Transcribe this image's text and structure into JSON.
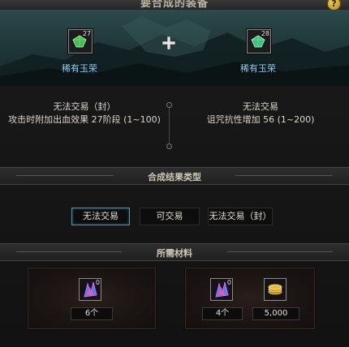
{
  "header": {
    "title": "要合成的装备",
    "help": "?"
  },
  "left_item": {
    "name": "稀有玉荣",
    "count": "27",
    "trade": "无法交易（封）",
    "effect": "攻击时附加出血效果 27阶段 (1~100)"
  },
  "right_item": {
    "name": "稀有玉荣",
    "count": "28",
    "trade": "无法交易",
    "effect": "诅咒抗性增加 56 (1~200)"
  },
  "result_section": {
    "title": "合成结果类型",
    "options": [
      "无法交易",
      "可交易",
      "无法交易（封）"
    ],
    "selected": "无法交易"
  },
  "materials_section": {
    "title": "所需材料",
    "material_1": {
      "slot_count": "0",
      "required": "6个"
    },
    "material_2": {
      "slot_count": "0",
      "required": "4个"
    },
    "gold": {
      "amount": "5,000"
    }
  },
  "colors": {
    "item_name": "#8fd3ff",
    "selected_border": "#5f8fa5"
  }
}
